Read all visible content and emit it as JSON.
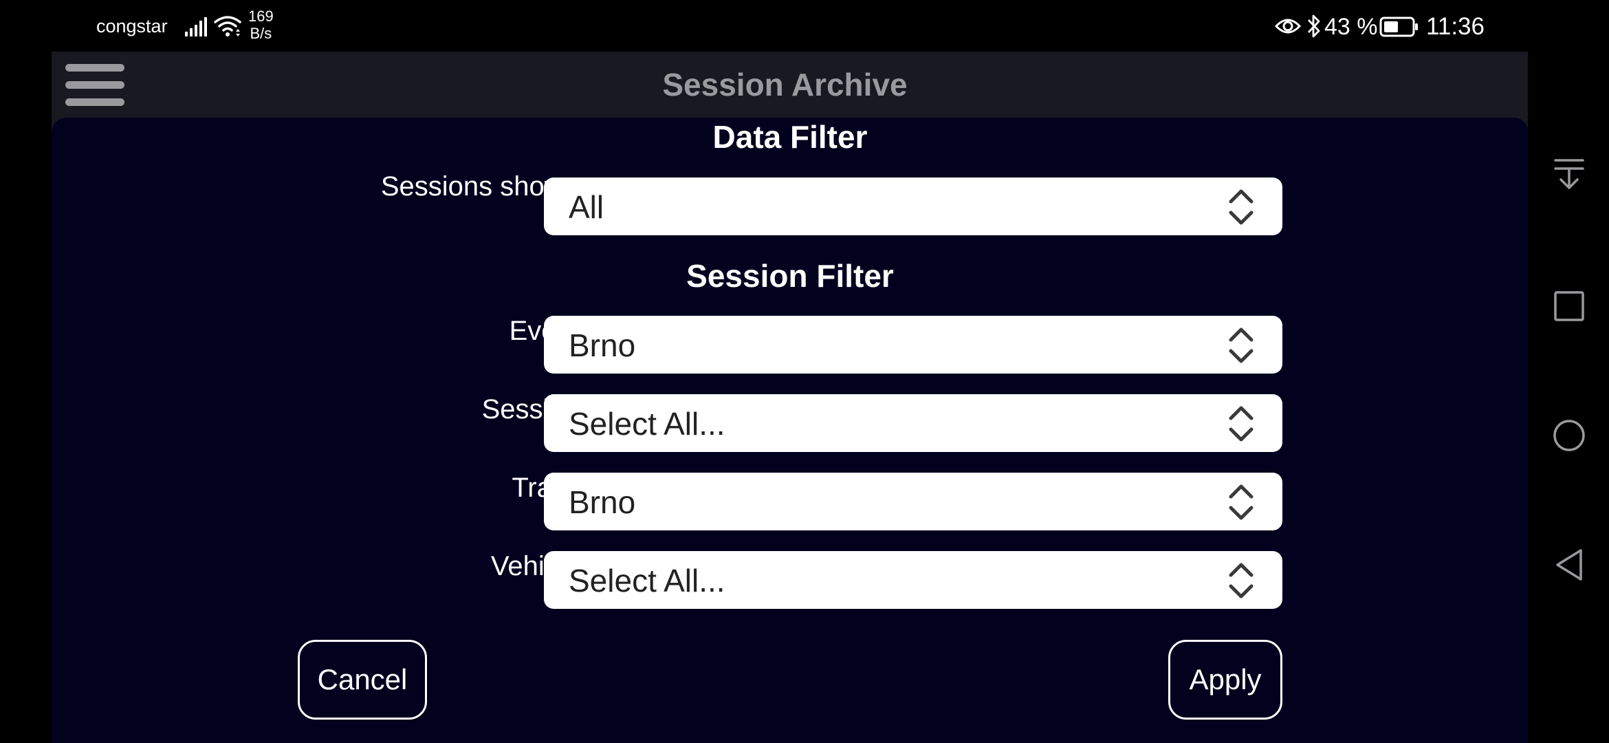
{
  "status_bar": {
    "carrier": "congstar",
    "net_speed_value": "169",
    "net_speed_unit": "B/s",
    "battery_percent": "43 %",
    "time": "11:36",
    "icons": [
      "signal-icon",
      "wifi-icon",
      "eye-icon",
      "bluetooth-icon",
      "battery-icon"
    ]
  },
  "header": {
    "title": "Session Archive",
    "menu_icon": "hamburger-menu-icon"
  },
  "dialog": {
    "data_filter": {
      "title": "Data Filter",
      "sessions_shown": {
        "label": "Sessions shown:",
        "value": "All"
      }
    },
    "session_filter": {
      "title": "Session Filter",
      "event": {
        "label": "Event:",
        "value": "Brno"
      },
      "session": {
        "label": "Session:",
        "value": "Select All..."
      },
      "track": {
        "label": "Track:",
        "value": "Brno"
      },
      "vehicle": {
        "label": "Vehicle:",
        "value": "Select All..."
      }
    },
    "cancel_label": "Cancel",
    "apply_label": "Apply"
  },
  "nav": {
    "icons": [
      "notification-pulldown-icon",
      "recents-icon",
      "home-icon",
      "back-icon"
    ]
  },
  "colors": {
    "status_background": "#000000",
    "app_header_background": "#191922",
    "header_text": "#9a9a9e",
    "dialog_background": "#02011e",
    "select_background": "#ffffff",
    "select_text": "#222222",
    "text": "#ffffff"
  }
}
